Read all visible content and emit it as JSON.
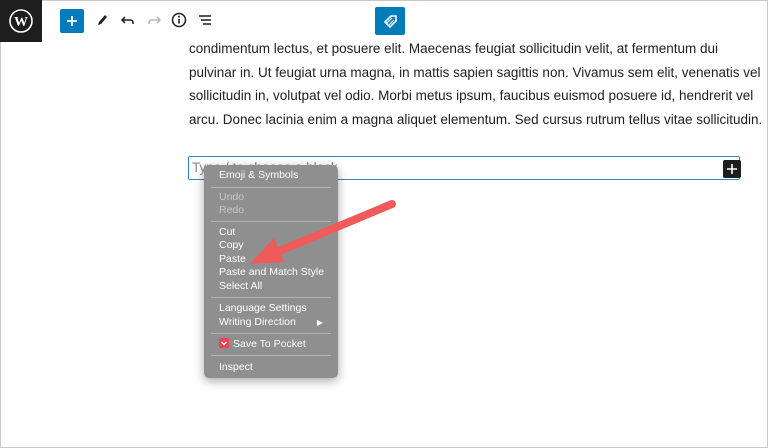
{
  "toolbar": {
    "logo_icon": "wordpress-logo-icon",
    "add_icon": "plus-icon",
    "edit_icon": "pencil-icon",
    "undo_icon": "undo-icon",
    "redo_icon": "redo-icon",
    "info_icon": "info-icon",
    "list_icon": "list-view-icon",
    "center_icon": "tag-icon",
    "accent_color": "#007cba"
  },
  "content": {
    "lines": [
      "condimentum lectus, et posuere elit. Maecenas feugiat sollicitudin velit, at fermentum dui",
      "pulvinar in. Ut feugiat urna magna, in mattis sapien sagittis non. Vivamus sem elit, venenatis vel",
      "sollicitudin in, volutpat vel odio. Morbi metus ipsum, faucibus euismod posuere id, hendrerit vel",
      "arcu. Donec lacinia enim a magna aliquet elementum. Sed cursus rutrum tellus vitae sollicitudin."
    ],
    "block_placeholder": "Type / to choose a block"
  },
  "context_menu": {
    "emoji": "Emoji & Symbols",
    "undo": "Undo",
    "redo": "Redo",
    "cut": "Cut",
    "copy": "Copy",
    "paste": "Paste",
    "paste_match": "Paste and Match Style",
    "select_all": "Select All",
    "language": "Language Settings",
    "writing_direction": "Writing Direction",
    "save_pocket": "Save To Pocket",
    "inspect": "Inspect",
    "arrow_color": "#ef5a5a"
  }
}
